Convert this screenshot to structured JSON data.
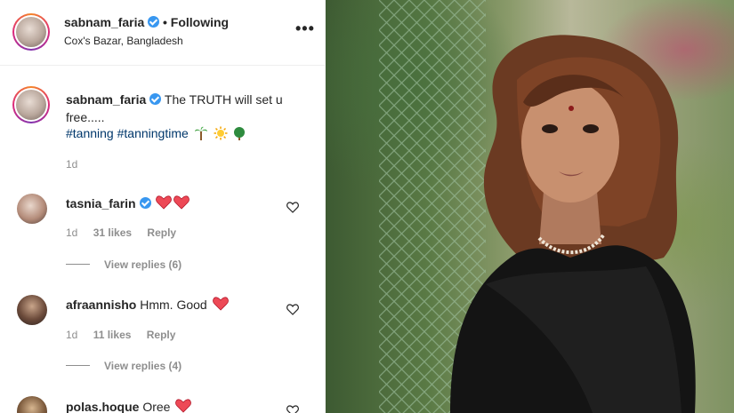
{
  "post": {
    "username": "sabnam_faria",
    "follow_status": "• Following",
    "location": "Cox's Bazar, Bangladesh",
    "more": "•••"
  },
  "caption": {
    "username": "sabnam_faria",
    "text": "The TRUTH will set u free.....",
    "hashtags": "#tanning #tanningtime",
    "time": "1d"
  },
  "comments": [
    {
      "username": "tasnia_farin",
      "text": "",
      "time": "1d",
      "likes": "31 likes",
      "reply": "Reply",
      "view_replies": "View replies (6)"
    },
    {
      "username": "afraannisho",
      "text": "Hmm. Good",
      "time": "1d",
      "likes": "11 likes",
      "reply": "Reply",
      "view_replies": "View replies (4)"
    },
    {
      "username": "polas.hoque",
      "text": "Oree"
    }
  ],
  "colors": {
    "verified": "#3897f0",
    "hashtag": "#00376b",
    "heart": "#ed4956",
    "muted": "#8e8e8e"
  },
  "icons": [
    "verified-badge-icon",
    "more-options-icon",
    "palm-tree-emoji",
    "sun-emoji",
    "tree-emoji",
    "red-heart-emoji",
    "heart-outline-icon"
  ]
}
